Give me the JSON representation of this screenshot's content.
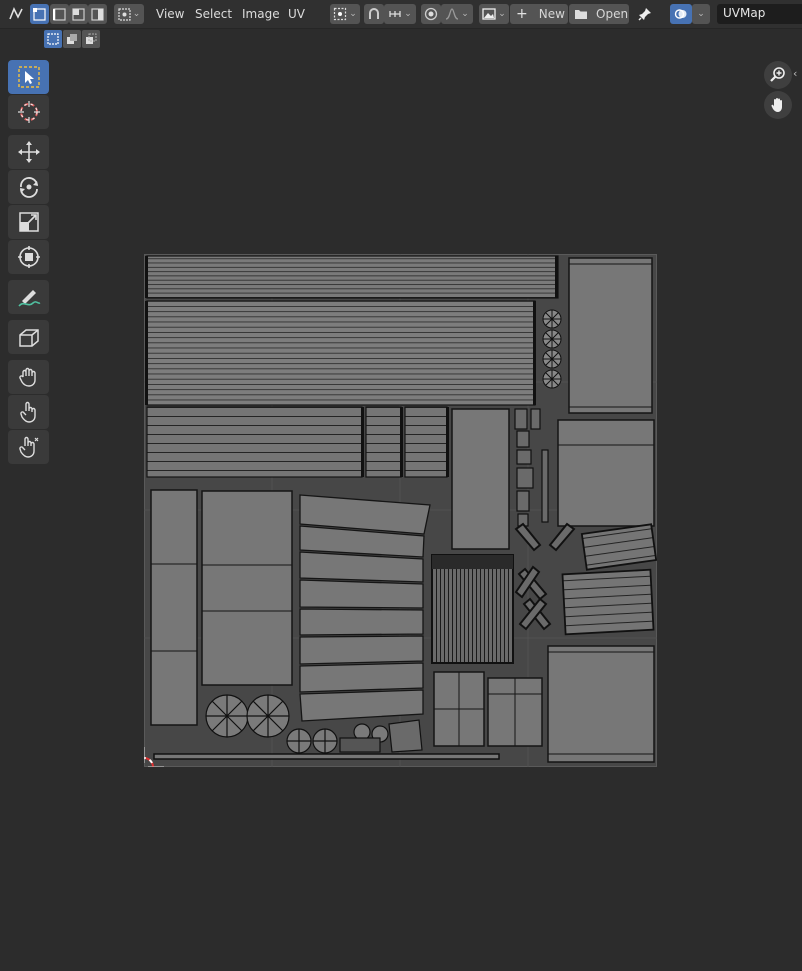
{
  "header": {
    "menu": {
      "view": "View",
      "select": "Select",
      "image": "Image",
      "uv": "UV"
    },
    "new_label": "New",
    "open_label": "Open",
    "uv_map_name": "UVMap"
  },
  "icons": {
    "editor_type": "uv-editor-icon",
    "sync": "uv-sync-icon",
    "vertex": "vertex-select-icon",
    "edge": "edge-select-icon",
    "face": "face-select-icon",
    "island": "island-select-icon",
    "pivot": "pivot-point-icon",
    "snap": "snap-icon",
    "snap_target": "snap-increment-icon",
    "proportional": "proportional-edit-icon",
    "falloff": "falloff-curve-icon",
    "browse_image": "image-browse-icon",
    "add": "plus-icon",
    "folder": "folder-icon",
    "pin": "pin-icon",
    "overlay": "overlay-icon",
    "zoom": "zoom-icon",
    "hand": "hand-icon",
    "collapse": "chevron-left-icon"
  },
  "toolbar": {
    "tools": [
      {
        "name": "select-box-tool",
        "icon": "select-box-icon",
        "active": true
      },
      {
        "name": "cursor-tool",
        "icon": "cursor-icon",
        "active": false
      },
      {
        "name": "move-tool",
        "icon": "move-icon",
        "active": false
      },
      {
        "name": "rotate-tool",
        "icon": "rotate-icon",
        "active": false
      },
      {
        "name": "scale-tool",
        "icon": "scale-icon",
        "active": false
      },
      {
        "name": "transform-tool",
        "icon": "transform-icon",
        "active": false
      },
      {
        "name": "annotate-tool",
        "icon": "annotate-icon",
        "active": false
      },
      {
        "name": "rip-region-tool",
        "icon": "rip-region-icon",
        "active": false
      },
      {
        "name": "grab-tool",
        "icon": "grab-icon",
        "active": false
      },
      {
        "name": "relax-tool",
        "icon": "relax-icon",
        "active": false
      },
      {
        "name": "pinch-tool",
        "icon": "pinch-icon",
        "active": false
      }
    ]
  },
  "colors": {
    "accent": "#4772b3",
    "background": "#2c2c2c",
    "uv_fill": "#787878",
    "uv_edge": "#111111",
    "cursor_red": "#e03030"
  }
}
